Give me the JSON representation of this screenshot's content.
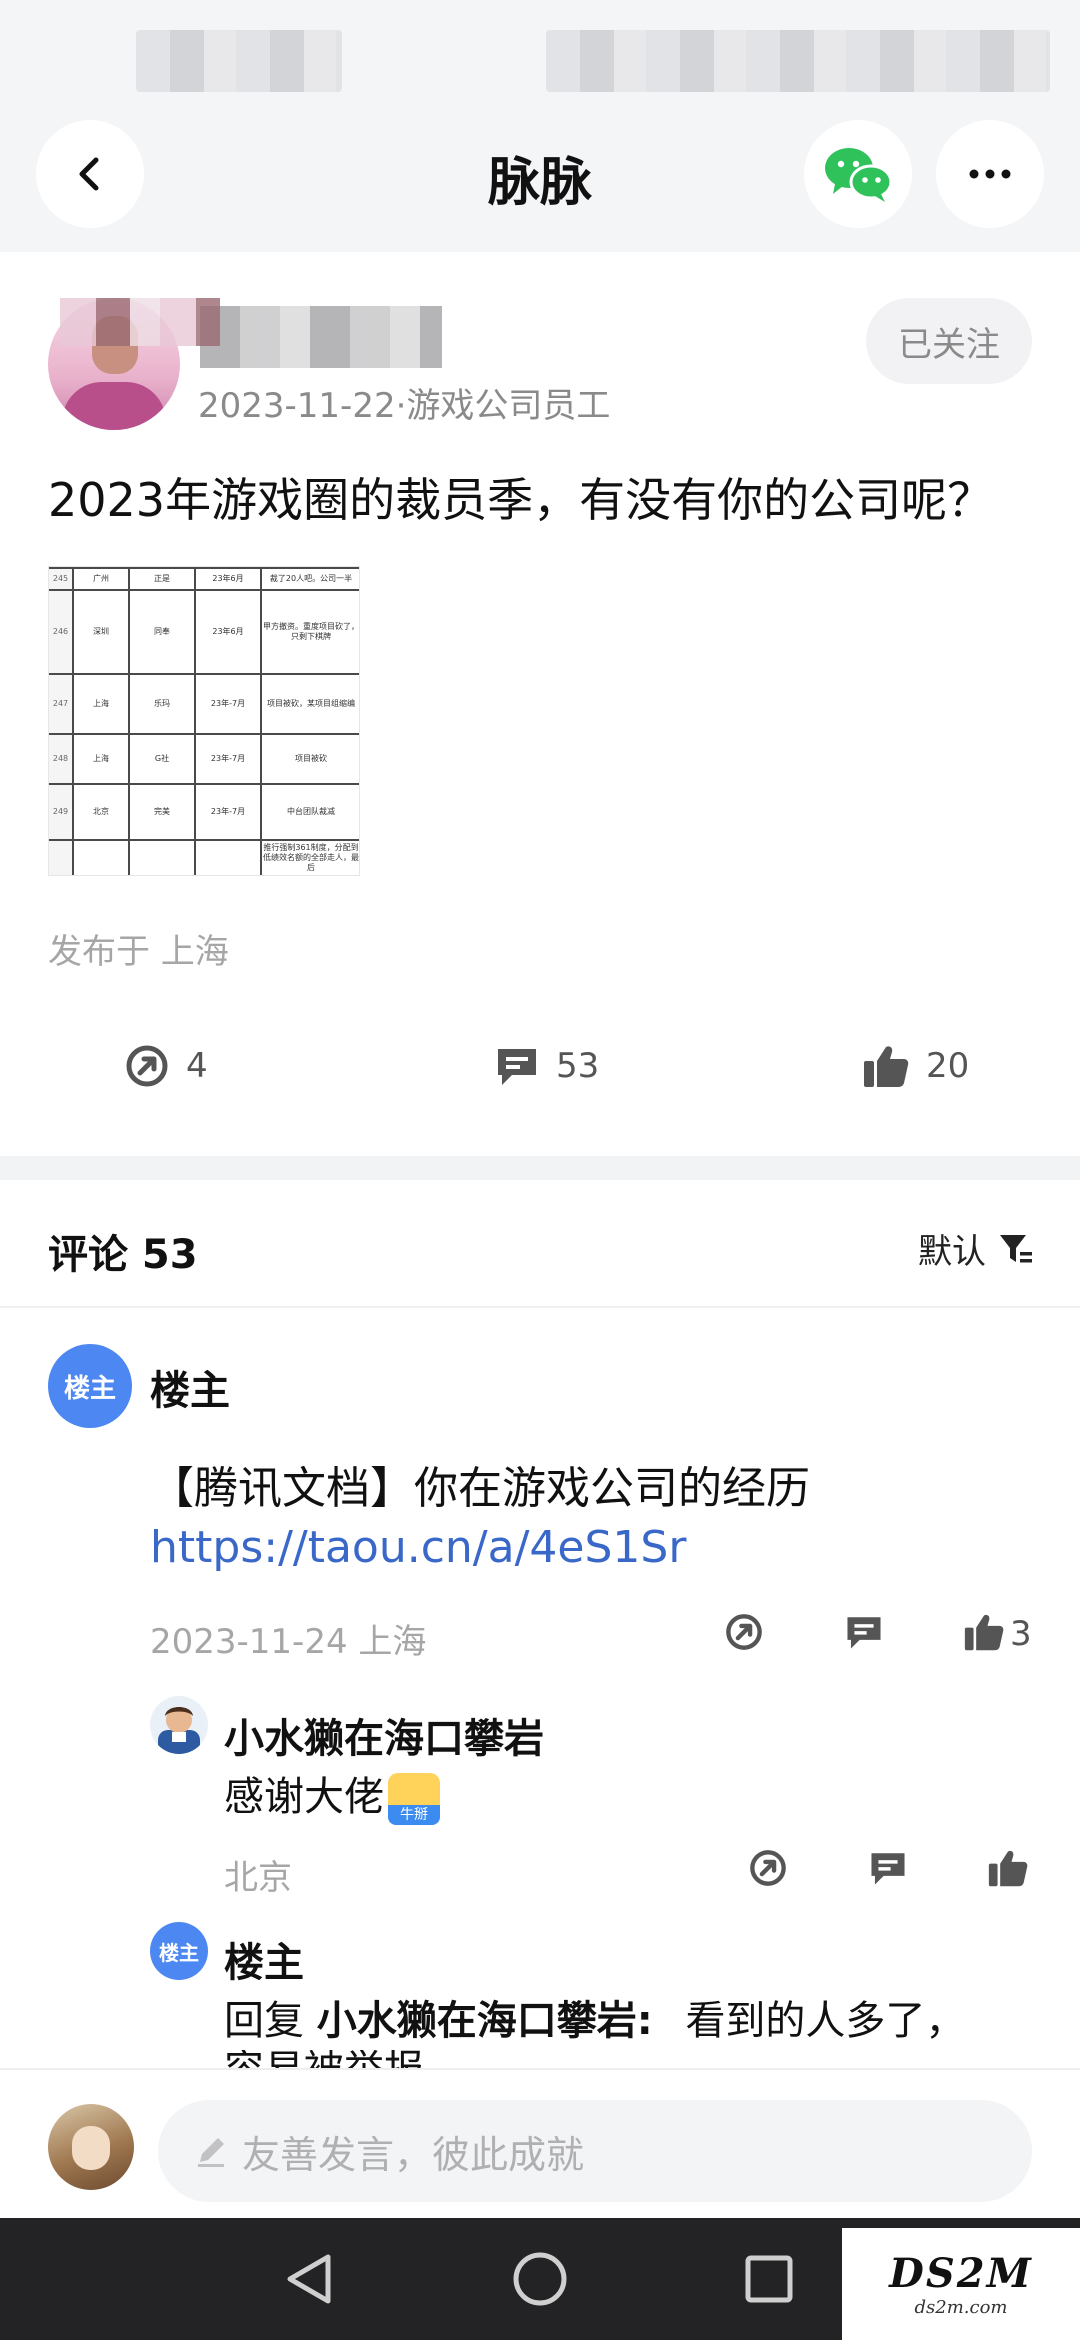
{
  "header": {
    "title": "脉脉"
  },
  "post": {
    "meta": "2023-11-22·游戏公司员工",
    "follow_label": "已关注",
    "text": "2023年游戏圈的裁员季，有没有你的公司呢？",
    "location": "发布于 上海",
    "thumbnail_rows": [
      {
        "no": "245",
        "city": "广州",
        "company": "正是",
        "date": "23年6月",
        "note": "裁了20人吧。公司一半"
      },
      {
        "no": "246",
        "city": "深圳",
        "company": "同奉",
        "date": "23年6月",
        "note": "甲方撤资。重度项目砍了，只剩下棋牌"
      },
      {
        "no": "247",
        "city": "上海",
        "company": "乐玛",
        "date": "23年-7月",
        "note": "项目被砍，某项目组缩编"
      },
      {
        "no": "248",
        "city": "上海",
        "company": "G社",
        "date": "23年-7月",
        "note": "项目被砍"
      },
      {
        "no": "249",
        "city": "北京",
        "company": "完美",
        "date": "23年-7月",
        "note": "中台团队裁减"
      },
      {
        "no": "",
        "city": "",
        "company": "",
        "date": "",
        "note": "推行强制361制度，分配到低绩效名额的全部走人，最后"
      }
    ],
    "actions": {
      "share_count": "4",
      "comment_count": "53",
      "like_count": "20"
    }
  },
  "comments": {
    "title": "评论 53",
    "sort_label": "默认",
    "items": [
      {
        "badge": "楼主",
        "name": "楼主",
        "body": "【腾讯文档】你在游戏公司的经历",
        "link": "https://taou.cn/a/4eS1Sr",
        "meta": "2023-11-24  上海",
        "like_count": "3"
      },
      {
        "name": "小水獭在海口攀岩",
        "body": "感谢大佬",
        "emoji_tag": "牛掰",
        "meta": "北京"
      },
      {
        "badge": "楼主",
        "name": "楼主",
        "reply_prefix": "回复",
        "reply_to": "小水獭在海口攀岩",
        "reply_colon": ":",
        "body": "看到的人多了，",
        "body_cut": "容易被举报"
      }
    ]
  },
  "input": {
    "placeholder": "友善发言，彼此成就"
  },
  "watermark": {
    "big": "DS2M",
    "small": "ds2m.com"
  },
  "colors": {
    "accent_blue": "#4c87f2",
    "link_blue": "#3a68c8",
    "wechat_green": "#2fc25b",
    "muted_gray": "#a6a6a6"
  }
}
